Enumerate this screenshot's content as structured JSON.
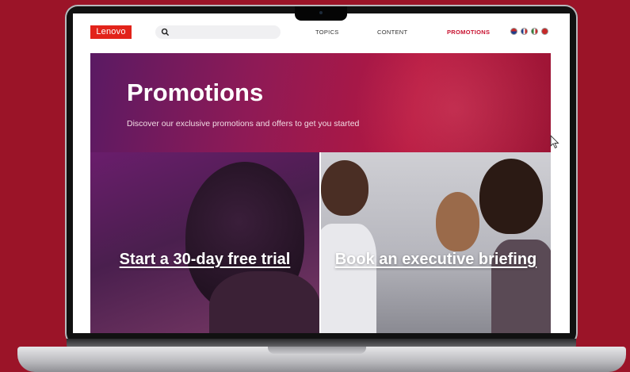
{
  "colors": {
    "background": "#9b1428",
    "brand_red": "#e2231a",
    "active_nav": "#c8102e"
  },
  "site": {
    "logo_text": "Lenovo",
    "search": {
      "placeholder": "",
      "icon": "search-icon"
    },
    "nav": [
      {
        "label": "TOPICS",
        "active": false
      },
      {
        "label": "CONTENT",
        "active": false
      },
      {
        "label": "PROMOTIONS",
        "active": true
      }
    ],
    "language_icons": [
      "flag-icon",
      "flag-icon",
      "flag-icon",
      "flag-icon"
    ]
  },
  "hero": {
    "title": "Promotions",
    "subtitle": "Discover our exclusive promotions and offers to get you started"
  },
  "cards": [
    {
      "title": "Start a 30-day free trial"
    },
    {
      "title": "Book an executive briefing"
    }
  ]
}
